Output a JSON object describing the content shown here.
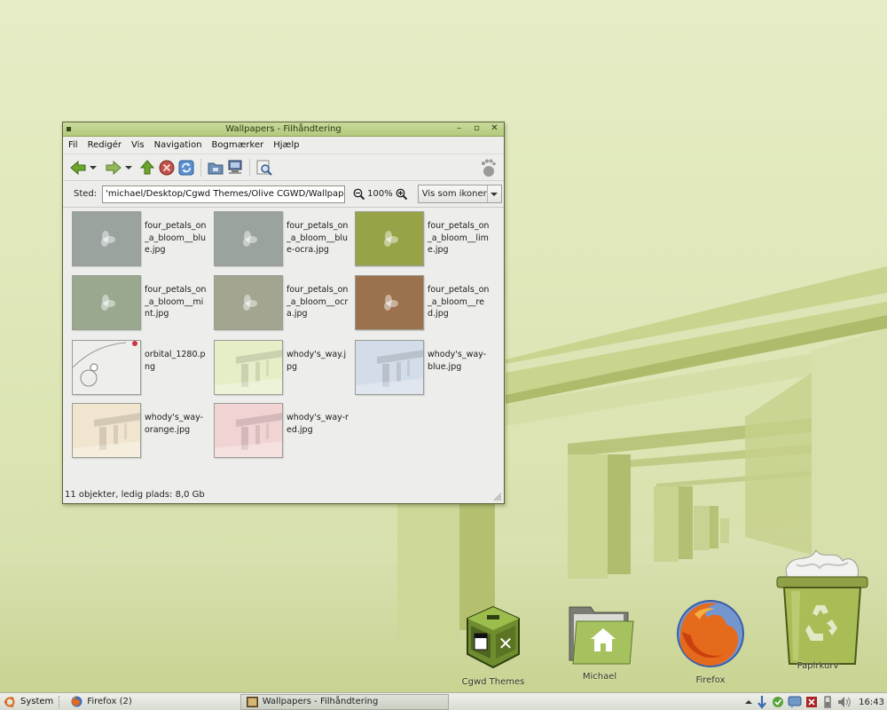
{
  "window": {
    "title": "Wallpapers - Filhåndtering",
    "controls": {
      "minimize": "–",
      "maximize": "▫",
      "close": "✕"
    }
  },
  "menu": [
    {
      "label": "Fil"
    },
    {
      "label": "Redigér"
    },
    {
      "label": "Vis"
    },
    {
      "label": "Navigation"
    },
    {
      "label": "Bogmærker"
    },
    {
      "label": "Hjælp"
    }
  ],
  "location": {
    "label": "Sted:",
    "path": "'michael/Desktop/Cgwd Themes/Olive CGWD/Wallpapers",
    "zoom": "100%",
    "view_mode": "Vis som ikoner"
  },
  "files": [
    {
      "name": "four_petals_on_a_bloom__blue.jpg",
      "color": "#9aa39e"
    },
    {
      "name": "four_petals_on_a_bloom__blue-ocra.jpg",
      "color": "#9ba49c"
    },
    {
      "name": "four_petals_on_a_bloom__lime.jpg",
      "color": "#98a348"
    },
    {
      "name": "four_petals_on_a_bloom__mint.jpg",
      "color": "#9aa88f"
    },
    {
      "name": "four_petals_on_a_bloom__ocra.jpg",
      "color": "#a3a590"
    },
    {
      "name": "four_petals_on_a_bloom__red.jpg",
      "color": "#9c714d"
    },
    {
      "name": "orbital_1280.png",
      "color": "#eeeeea"
    },
    {
      "name": "whody's_way.jpg",
      "color": "#dde8b4"
    },
    {
      "name": "whody's_way-blue.jpg",
      "color": "#c4d0e2"
    },
    {
      "name": "whody's_way-orange.jpg",
      "color": "#ecdcbf"
    },
    {
      "name": "whody's_way-red.jpg",
      "color": "#ecc4c4"
    }
  ],
  "status": "11 objekter, ledig plads: 8,0 Gb",
  "desktop_icons": [
    {
      "label": "Cgwd Themes"
    },
    {
      "label": "Michael"
    },
    {
      "label": "Firefox"
    },
    {
      "label": "Papirkurv"
    }
  ],
  "taskbar": {
    "system": "System",
    "tasks": [
      {
        "label": "Firefox (2)"
      },
      {
        "label": "Wallpapers - Filhåndtering"
      }
    ],
    "clock": "16:43"
  }
}
